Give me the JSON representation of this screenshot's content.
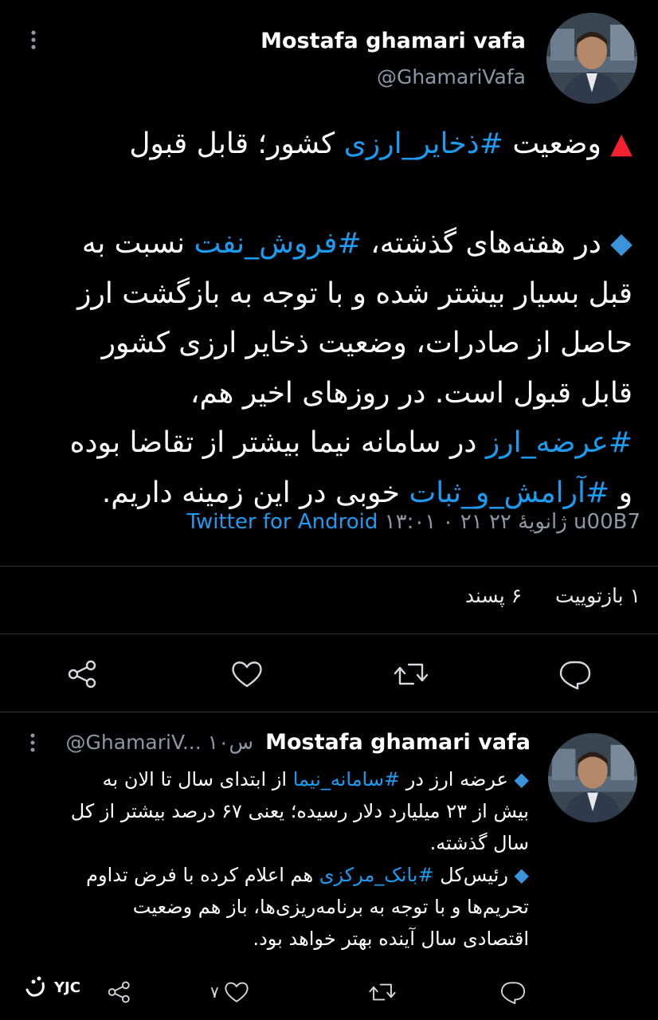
{
  "main_tweet": {
    "display_name": "Mostafa ghamari vafa",
    "handle": "@GhamariVafa",
    "lines": [
      {
        "parts": [
          {
            "t": "▲ ",
            "c": "red"
          },
          {
            "t": "وضعیت "
          },
          {
            "t": "#ذخایر_ارزی",
            "c": "link"
          },
          {
            "t": " کشور؛ قابل قبول"
          }
        ]
      },
      {
        "parts": []
      },
      {
        "parts": [
          {
            "t": "◆ ",
            "c": "blue"
          },
          {
            "t": "در هفته‌های گذشته، "
          },
          {
            "t": "#فروش_نفت",
            "c": "link"
          },
          {
            "t": " نسبت به"
          }
        ]
      },
      {
        "parts": [
          {
            "t": "قبل بسیار بیشتر شده و با توجه به بازگشت ارز"
          }
        ]
      },
      {
        "parts": [
          {
            "t": "حاصل از صادرات، وضعیت ذخایر ارزی کشور"
          }
        ]
      },
      {
        "parts": [
          {
            "t": "قابل قبول است. در روزهای اخیر هم،"
          }
        ]
      },
      {
        "parts": [
          {
            "t": "#عرضه_ارز",
            "c": "link"
          },
          {
            "t": " در سامانه نیما بیشتر از تقاضا بوده"
          }
        ]
      },
      {
        "parts": [
          {
            "t": "و "
          },
          {
            "t": "#آرامش_و_ثبات",
            "c": "link"
          },
          {
            "t": " خوبی در این زمینه داریم."
          }
        ]
      }
    ],
    "timestamp": "۱۳:۰۱ ۰ ۲۱ ژانویهٔ ۲۲ u00B7",
    "source": "Twitter for Android",
    "retweets_label": "۱ بازتوییت",
    "likes_label": "۶ پسند"
  },
  "reply_tweet": {
    "display_name": "Mostafa ghamari vafa",
    "handle_time": "@GhamariV... ۱۰س",
    "lines": [
      {
        "parts": [
          {
            "t": "◆ ",
            "c": "blue"
          },
          {
            "t": "عرضه ارز در "
          },
          {
            "t": "#سامانه_نیما",
            "c": "link"
          },
          {
            "t": " از ابتدای سال تا الان به"
          }
        ]
      },
      {
        "parts": [
          {
            "t": "بیش از ۲۳ میلیارد دلار رسیده؛ یعنی ۶۷ درصد بیشتر از کل"
          }
        ]
      },
      {
        "parts": [
          {
            "t": "سال گذشته."
          }
        ]
      },
      {
        "parts": [
          {
            "t": "◆ ",
            "c": "blue"
          },
          {
            "t": "رئیس‌کل "
          },
          {
            "t": "#بانک_مرکزی",
            "c": "link"
          },
          {
            "t": " هم اعلام کرده با فرض تداوم"
          }
        ]
      },
      {
        "parts": [
          {
            "t": "تحریم‌ها و با توجه به برنامه‌ریزی‌ها، باز هم وضعیت"
          }
        ]
      },
      {
        "parts": [
          {
            "t": "اقتصادی سال آینده بهتر خواهد بود."
          }
        ]
      }
    ],
    "like_count": "۷"
  },
  "watermark": "YJC",
  "colors": {
    "background": "#000000",
    "link": "#1d9bf0",
    "triangle": "#f4212e",
    "diamond": "#3b94d9",
    "muted": "#8b98a5",
    "divider": "#2f3336"
  },
  "icons": [
    "more-vertical-icon",
    "share-icon",
    "like-icon",
    "retweet-icon",
    "reply-icon",
    "yjc-logo"
  ]
}
